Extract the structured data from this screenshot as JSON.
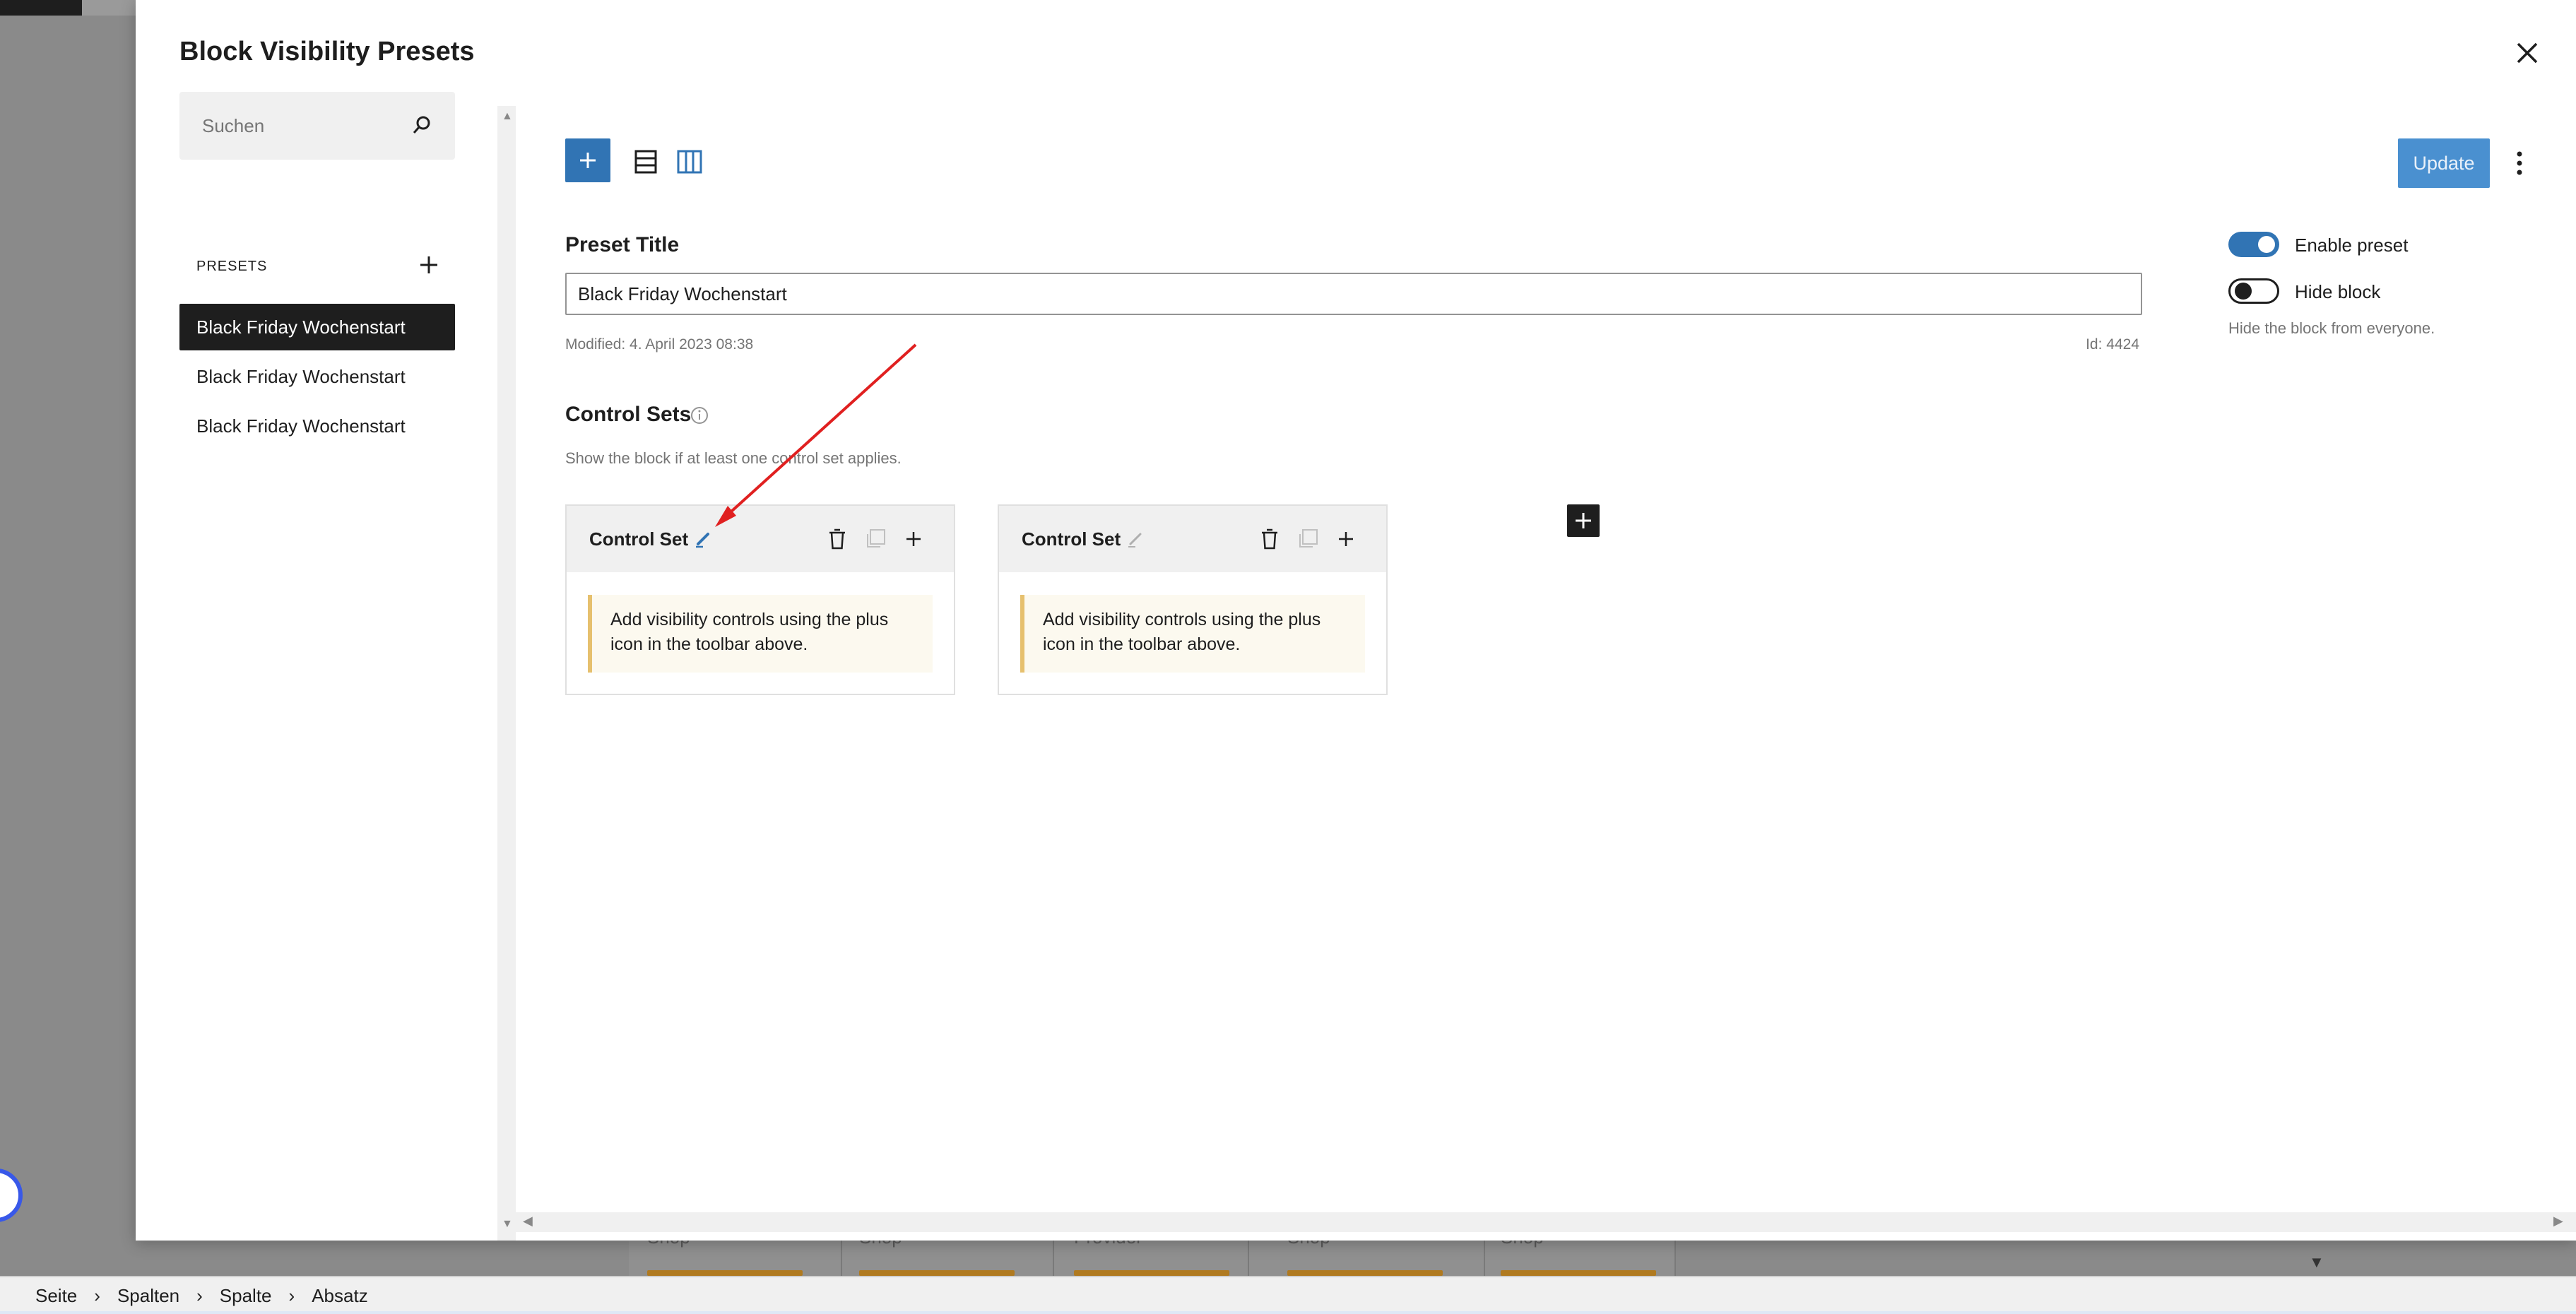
{
  "modal": {
    "title": "Block Visibility Presets"
  },
  "sidebar": {
    "search_placeholder": "Suchen",
    "presets_label": "PRESETS",
    "items": [
      {
        "label": "Black Friday Wochenstart",
        "active": true
      },
      {
        "label": "Black Friday Wochenstart",
        "active": false
      },
      {
        "label": "Black Friday Wochenstart",
        "active": false
      }
    ]
  },
  "toolbar": {
    "update_label": "Update"
  },
  "preset": {
    "title_label": "Preset Title",
    "title_value": "Black Friday Wochenstart",
    "modified": "Modified: 4. April 2023 08:38",
    "id": "Id: 4424"
  },
  "settings": {
    "enable_label": "Enable preset",
    "enable_on": true,
    "hide_label": "Hide block",
    "hide_on": false,
    "hide_help": "Hide the block from everyone."
  },
  "control_sets": {
    "title": "Control Sets",
    "description": "Show the block if at least one control set applies.",
    "cards": [
      {
        "title": "Control Set",
        "notice": "Add visibility controls using the plus icon in the toolbar above."
      },
      {
        "title": "Control Set",
        "notice": "Add visibility controls using the plus icon in the toolbar above."
      }
    ]
  },
  "background_page": {
    "column_labels": [
      "Shop",
      "Shop",
      "Provider",
      "Shop",
      "Shop"
    ]
  },
  "breadcrumb": [
    "Seite",
    "Spalten",
    "Spalte",
    "Absatz"
  ],
  "colors": {
    "accent": "#3174b4",
    "update_button": "#4a90d0",
    "annotation_arrow": "#e02020",
    "notice_border": "#e6c06e",
    "notice_background": "#fcf9ef"
  }
}
